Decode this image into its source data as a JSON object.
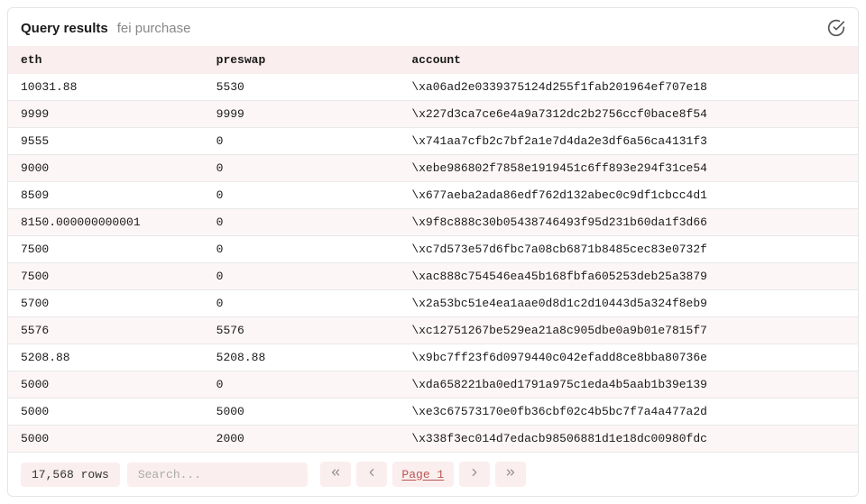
{
  "header": {
    "title": "Query results",
    "subtitle": "fei purchase"
  },
  "columns": {
    "eth": "eth",
    "preswap": "preswap",
    "account": "account"
  },
  "rows": [
    {
      "eth": "10031.88",
      "preswap": "5530",
      "account": "\\xa06ad2e0339375124d255f1fab201964ef707e18"
    },
    {
      "eth": "9999",
      "preswap": "9999",
      "account": "\\x227d3ca7ce6e4a9a7312dc2b2756ccf0bace8f54"
    },
    {
      "eth": "9555",
      "preswap": "0",
      "account": "\\x741aa7cfb2c7bf2a1e7d4da2e3df6a56ca4131f3"
    },
    {
      "eth": "9000",
      "preswap": "0",
      "account": "\\xebe986802f7858e1919451c6ff893e294f31ce54"
    },
    {
      "eth": "8509",
      "preswap": "0",
      "account": "\\x677aeba2ada86edf762d132abec0c9df1cbcc4d1"
    },
    {
      "eth": "8150.000000000001",
      "preswap": "0",
      "account": "\\x9f8c888c30b05438746493f95d231b60da1f3d66"
    },
    {
      "eth": "7500",
      "preswap": "0",
      "account": "\\xc7d573e57d6fbc7a08cb6871b8485cec83e0732f"
    },
    {
      "eth": "7500",
      "preswap": "0",
      "account": "\\xac888c754546ea45b168fbfa605253deb25a3879"
    },
    {
      "eth": "5700",
      "preswap": "0",
      "account": "\\x2a53bc51e4ea1aae0d8d1c2d10443d5a324f8eb9"
    },
    {
      "eth": "5576",
      "preswap": "5576",
      "account": "\\xc12751267be529ea21a8c905dbe0a9b01e7815f7"
    },
    {
      "eth": "5208.88",
      "preswap": "5208.88",
      "account": "\\x9bc7ff23f6d0979440c042efadd8ce8bba80736e"
    },
    {
      "eth": "5000",
      "preswap": "0",
      "account": "\\xda658221ba0ed1791a975c1eda4b5aab1b39e139"
    },
    {
      "eth": "5000",
      "preswap": "5000",
      "account": "\\xe3c67573170e0fb36cbf02c4b5bc7f7a4a477a2d"
    },
    {
      "eth": "5000",
      "preswap": "2000",
      "account": "\\x338f3ec014d7edacb98506881d1e18dc00980fdc"
    }
  ],
  "footer": {
    "row_count": "17,568 rows",
    "search_placeholder": "Search...",
    "page_label": "Page 1"
  }
}
